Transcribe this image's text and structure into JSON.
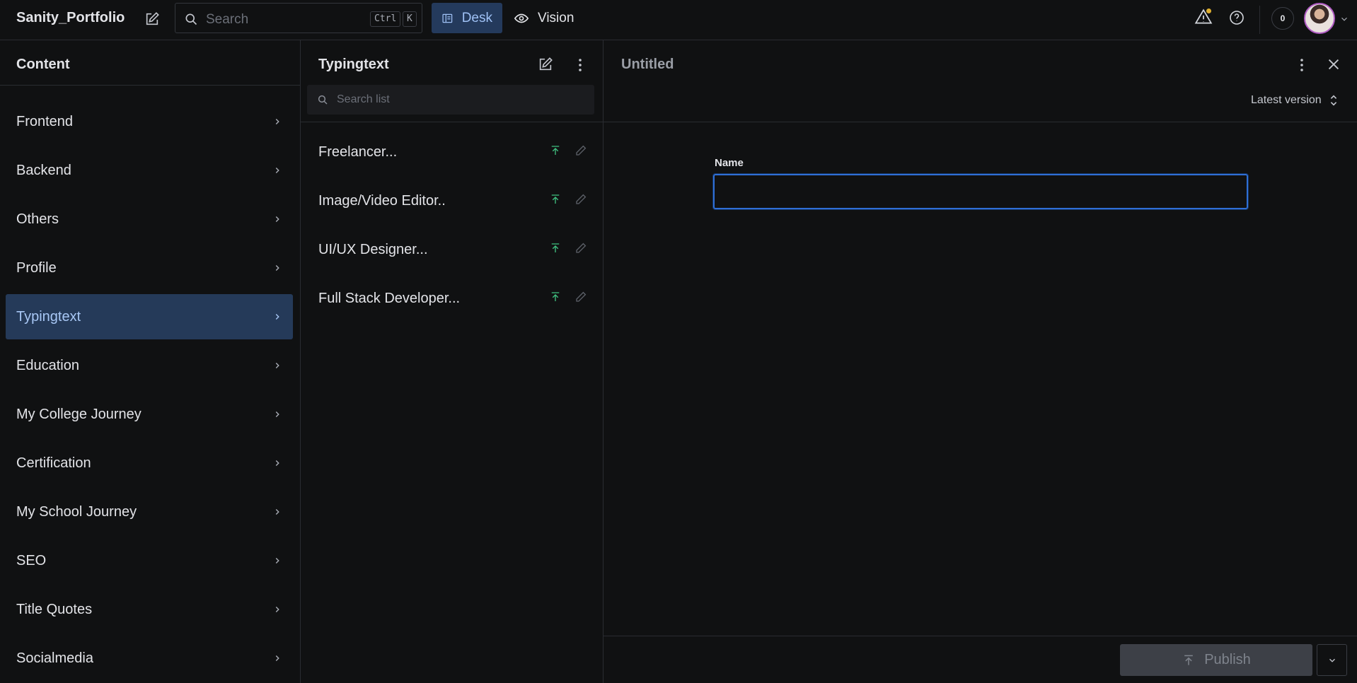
{
  "topbar": {
    "brand": "Sanity_Portfolio",
    "search_placeholder": "Search",
    "shortcut_ctrl": "Ctrl",
    "shortcut_key": "K",
    "tools": [
      {
        "label": "Desk",
        "active": true,
        "icon": "desk-icon"
      },
      {
        "label": "Vision",
        "active": false,
        "icon": "eye-icon"
      }
    ],
    "notification_count": "0",
    "accent_color": "#243a5c"
  },
  "content_pane": {
    "title": "Content",
    "items": [
      {
        "label": "Frontend"
      },
      {
        "label": "Backend"
      },
      {
        "label": "Others"
      },
      {
        "label": "Profile"
      },
      {
        "label": "Typingtext",
        "active": true
      },
      {
        "label": "Education"
      },
      {
        "label": "My College Journey"
      },
      {
        "label": "Certification"
      },
      {
        "label": "My School Journey"
      },
      {
        "label": "SEO"
      },
      {
        "label": "Title Quotes"
      },
      {
        "label": "Socialmedia"
      }
    ]
  },
  "list_pane": {
    "title": "Typingtext",
    "search_placeholder": "Search list",
    "documents": [
      {
        "title": "Freelancer..."
      },
      {
        "title": "Image/Video Editor.."
      },
      {
        "title": "UI/UX Designer..."
      },
      {
        "title": "Full Stack Developer..."
      }
    ],
    "status_color": "#3fbf7f"
  },
  "editor": {
    "title": "Untitled",
    "version_label": "Latest version",
    "field_label": "Name",
    "field_value": "",
    "publish_label": "Publish",
    "focus_color": "#2f6fd6"
  }
}
